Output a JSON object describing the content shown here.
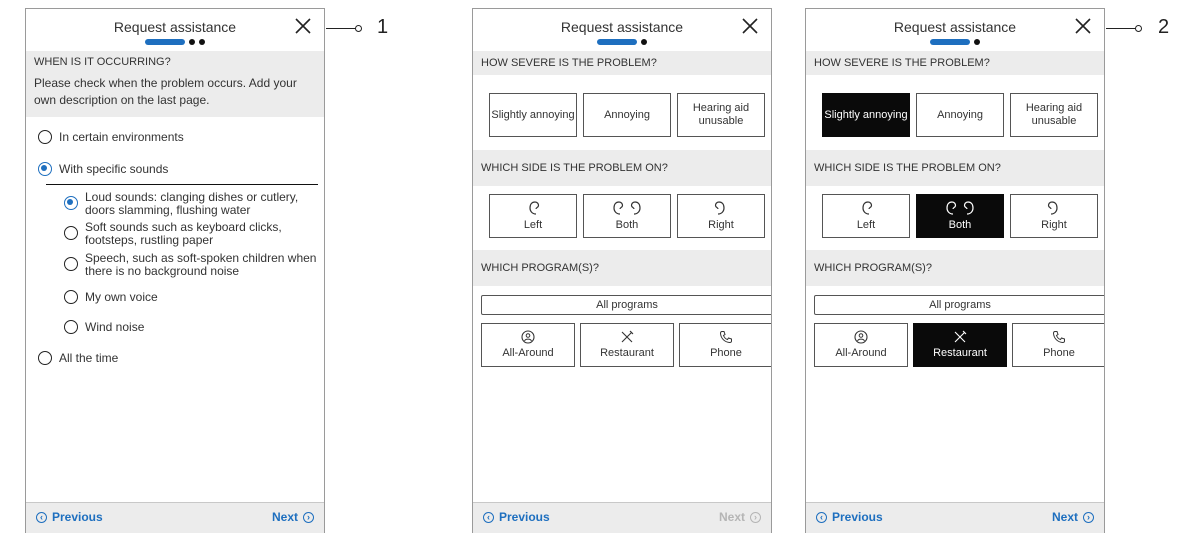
{
  "panel1": {
    "title": "Request assistance",
    "section": "WHEN IS IT OCCURRING?",
    "description": "Please check when the problem occurs. Add your own description on the last page.",
    "options": [
      {
        "label": "In certain environments",
        "selected": false
      },
      {
        "label": "With specific sounds",
        "selected": true
      }
    ],
    "sub_options": [
      {
        "line1": "Loud sounds: clanging dishes or cutlery,",
        "line2": "doors slamming, flushing water",
        "selected": true
      },
      {
        "line1": "Soft sounds such as keyboard clicks,",
        "line2": "footsteps, rustling paper",
        "selected": false
      },
      {
        "line1": "Speech, such as soft-spoken children when",
        "line2": "there is no background noise",
        "selected": false
      },
      {
        "line1": "My own voice",
        "line2": "",
        "selected": false
      },
      {
        "line1": "Wind noise",
        "line2": "",
        "selected": false
      }
    ],
    "last_option": {
      "label": "All the time",
      "selected": false
    },
    "prev": "Previous",
    "next": "Next"
  },
  "panel2": {
    "title": "Request assistance",
    "severity_section": "HOW SEVERE IS THE PROBLEM?",
    "severity": [
      "Slightly annoying",
      "Annoying",
      "Hearing aid unusable"
    ],
    "side_section": "WHICH SIDE IS THE PROBLEM ON?",
    "sides": [
      "Left",
      "Both",
      "Right"
    ],
    "program_section": "WHICH PROGRAM(S)?",
    "all_programs": "All programs",
    "programs": [
      "All-Around",
      "Restaurant",
      "Phone"
    ],
    "prev": "Previous",
    "next": "Next"
  },
  "panel3": {
    "title": "Request assistance",
    "severity_section": "HOW SEVERE IS THE PROBLEM?",
    "severity": [
      "Slightly annoying",
      "Annoying",
      "Hearing aid unusable"
    ],
    "side_section": "WHICH SIDE IS THE PROBLEM ON?",
    "sides": [
      "Left",
      "Both",
      "Right"
    ],
    "program_section": "WHICH PROGRAM(S)?",
    "all_programs": "All programs",
    "programs": [
      "All-Around",
      "Restaurant",
      "Phone"
    ],
    "prev": "Previous",
    "next": "Next"
  },
  "callouts": [
    "1",
    "2"
  ],
  "icons": {
    "close": "close-icon",
    "ear_left": "left-ear-icon",
    "ear_right": "right-ear-icon",
    "program_all_around": "all-around-icon",
    "program_restaurant": "fork-knife-icon",
    "program_phone": "phone-icon",
    "prev": "chevron-left-circle-icon",
    "next": "chevron-right-circle-icon"
  },
  "colors": {
    "accent": "#1e6fbf",
    "selected_bg": "#0a0a0a",
    "section_bg": "#ececec",
    "disabled": "#b5b5b5"
  }
}
